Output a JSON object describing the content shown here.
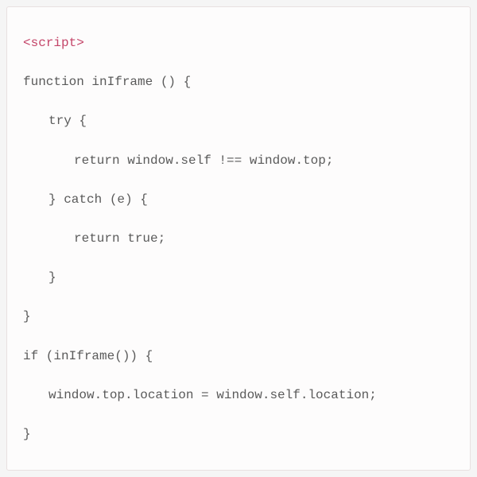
{
  "code": {
    "line1": "<script>",
    "line2": "function inIframe () {",
    "line3": "try {",
    "line4": "return window.self !== window.top;",
    "line5": "} catch (e) {",
    "line6": "return true;",
    "line7": "}",
    "line8": "}",
    "line9": "if (inIframe()) {",
    "line10": "window.top.location = window.self.location;",
    "line11": "}"
  }
}
